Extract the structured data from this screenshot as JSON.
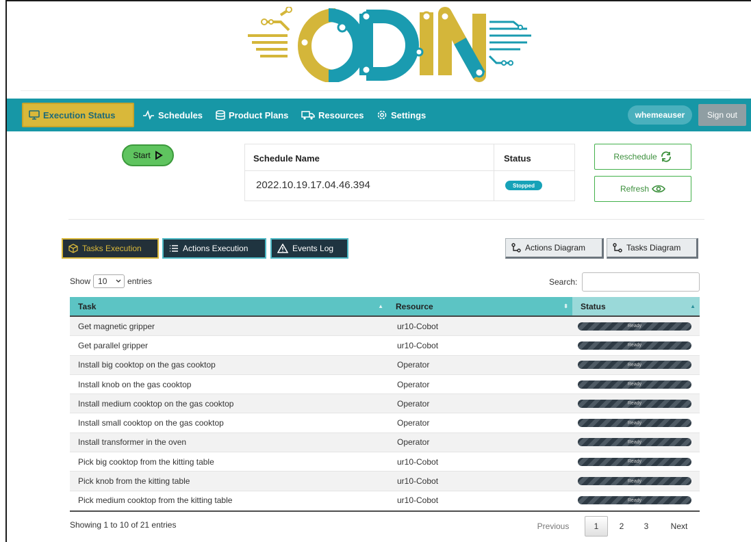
{
  "logo": {
    "text": "ODIN"
  },
  "nav": {
    "items": [
      {
        "label": "Execution Status",
        "icon": "monitor-icon"
      },
      {
        "label": "Schedules",
        "icon": "activity-icon"
      },
      {
        "label": "Product Plans",
        "icon": "database-icon"
      },
      {
        "label": "Resources",
        "icon": "truck-icon"
      },
      {
        "label": "Settings",
        "icon": "gear-icon"
      }
    ],
    "user": "whemeauser",
    "signout": "Sign out"
  },
  "controls": {
    "start": "Start",
    "reschedule": "Reschedule",
    "refresh": "Refresh"
  },
  "schedule": {
    "name_header": "Schedule Name",
    "status_header": "Status",
    "name": "2022.10.19.17.04.46.394",
    "status": "Stopped"
  },
  "tabs": {
    "tasks": "Tasks Execution",
    "actions": "Actions Execution",
    "events": "Events Log",
    "actions_diagram": "Actions Diagram",
    "tasks_diagram": "Tasks Diagram"
  },
  "datatable": {
    "show": "Show",
    "length": "10",
    "entries": "entries",
    "search_label": "Search:",
    "columns": [
      "Task",
      "Resource",
      "Status"
    ],
    "rows": [
      {
        "task": "Get magnetic gripper",
        "resource": "ur10-Cobot",
        "status": "Ready"
      },
      {
        "task": "Get parallel gripper",
        "resource": "ur10-Cobot",
        "status": "Ready"
      },
      {
        "task": "Install big cooktop on the gas cooktop",
        "resource": "Operator",
        "status": "Ready"
      },
      {
        "task": "Install knob on the gas cooktop",
        "resource": "Operator",
        "status": "Ready"
      },
      {
        "task": "Install medium cooktop on the gas cooktop",
        "resource": "Operator",
        "status": "Ready"
      },
      {
        "task": "Install small cooktop on the gas cooktop",
        "resource": "Operator",
        "status": "Ready"
      },
      {
        "task": "Install transformer in the oven",
        "resource": "Operator",
        "status": "Ready"
      },
      {
        "task": "Pick big cooktop from the kitting table",
        "resource": "ur10-Cobot",
        "status": "Ready"
      },
      {
        "task": "Pick knob from the kitting table",
        "resource": "ur10-Cobot",
        "status": "Ready"
      },
      {
        "task": "Pick medium cooktop from the kitting table",
        "resource": "ur10-Cobot",
        "status": "Ready"
      }
    ],
    "info": "Showing 1 to 10 of 21 entries",
    "pagination": {
      "previous": "Previous",
      "pages": [
        "1",
        "2",
        "3"
      ],
      "current": "1",
      "next": "Next"
    }
  },
  "colors": {
    "navbar": "#1797a6",
    "accent_gold": "#d9b83a",
    "success": "#42b04a",
    "table_header": "#5cc4c4"
  }
}
